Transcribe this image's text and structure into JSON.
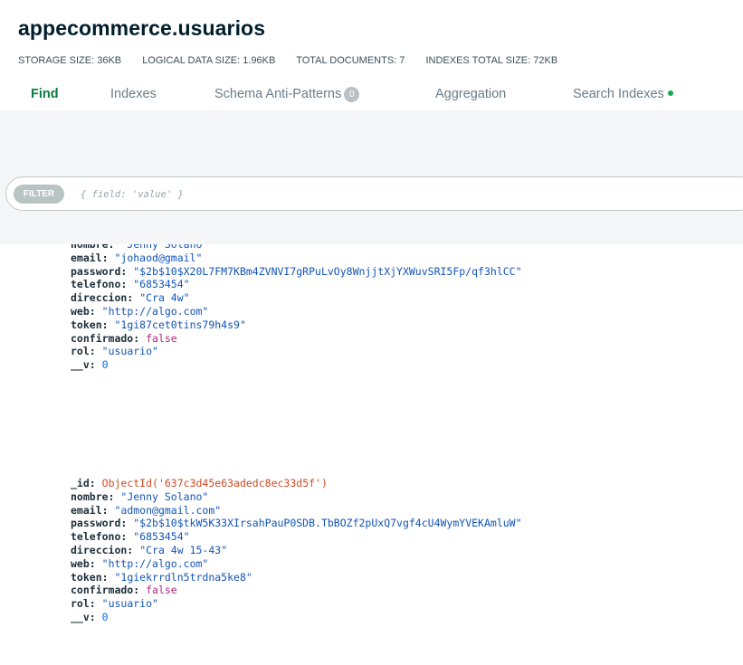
{
  "collection": {
    "title": "appecommerce.usuarios",
    "stats": [
      "STORAGE SIZE: 36KB",
      "LOGICAL DATA SIZE: 1.96KB",
      "TOTAL DOCUMENTS: 7",
      "INDEXES TOTAL SIZE: 72KB"
    ]
  },
  "tabs": [
    {
      "label": "Find",
      "active": true
    },
    {
      "label": "Indexes"
    },
    {
      "label": "Schema Anti-Patterns",
      "badge": "0"
    },
    {
      "label": "Aggregation"
    },
    {
      "label": "Search Indexes"
    }
  ],
  "filter": {
    "label": "FILTER",
    "placeholder": "{ field: 'value' }"
  },
  "colors": {
    "accent": "#0c7a3f",
    "key": "#1c2d38",
    "string": "#1254b7",
    "objectid": "#cf4a22",
    "boolean": "#b0287b",
    "number": "#016bf8"
  },
  "documents": [
    {
      "fields": [
        {
          "key": "nombre:",
          "value": "\"Jenny Solano\"",
          "type": "s"
        },
        {
          "key": "email:",
          "value": "\"johaod@gmail\"",
          "type": "s"
        },
        {
          "key": "password:",
          "value": "\"$2b$10$X20L7FM7KBm4ZVNVI7gRPuLvOy8WnjjtXjYXWuvSRI5Fp/qf3hlCC\"",
          "type": "s"
        },
        {
          "key": "telefono:",
          "value": "\"6853454\"",
          "type": "s"
        },
        {
          "key": "direccion:",
          "value": "\"Cra 4w\"",
          "type": "s"
        },
        {
          "key": "web:",
          "value": "\"http://algo.com\"",
          "type": "s"
        },
        {
          "key": "token:",
          "value": "\"1gi87cet0tins79h4s9\"",
          "type": "s"
        },
        {
          "key": "confirmado:",
          "value": "false",
          "type": "b"
        },
        {
          "key": "rol:",
          "value": "\"usuario\"",
          "type": "s"
        },
        {
          "key": "__v:",
          "value": "0",
          "type": "n"
        }
      ]
    },
    {
      "fields": [
        {
          "key": "_id:",
          "value": "ObjectId('637c3d45e63adedc8ec33d5f')",
          "type": "oid"
        },
        {
          "key": "nombre:",
          "value": "\"Jenny Solano\"",
          "type": "s"
        },
        {
          "key": "email:",
          "value": "\"admon@gmail.com\"",
          "type": "s"
        },
        {
          "key": "password:",
          "value": "\"$2b$10$tkW5K33XIrsahPauP0SDB.TbBOZf2pUxQ7vgf4cU4WymYVEKAmluW\"",
          "type": "s"
        },
        {
          "key": "telefono:",
          "value": "\"6853454\"",
          "type": "s"
        },
        {
          "key": "direccion:",
          "value": "\"Cra 4w 15-43\"",
          "type": "s"
        },
        {
          "key": "web:",
          "value": "\"http://algo.com\"",
          "type": "s"
        },
        {
          "key": "token:",
          "value": "\"1giekrrdln5trdna5ke8\"",
          "type": "s"
        },
        {
          "key": "confirmado:",
          "value": "false",
          "type": "b"
        },
        {
          "key": "rol:",
          "value": "\"usuario\"",
          "type": "s"
        },
        {
          "key": "__v:",
          "value": "0",
          "type": "n"
        }
      ]
    }
  ]
}
